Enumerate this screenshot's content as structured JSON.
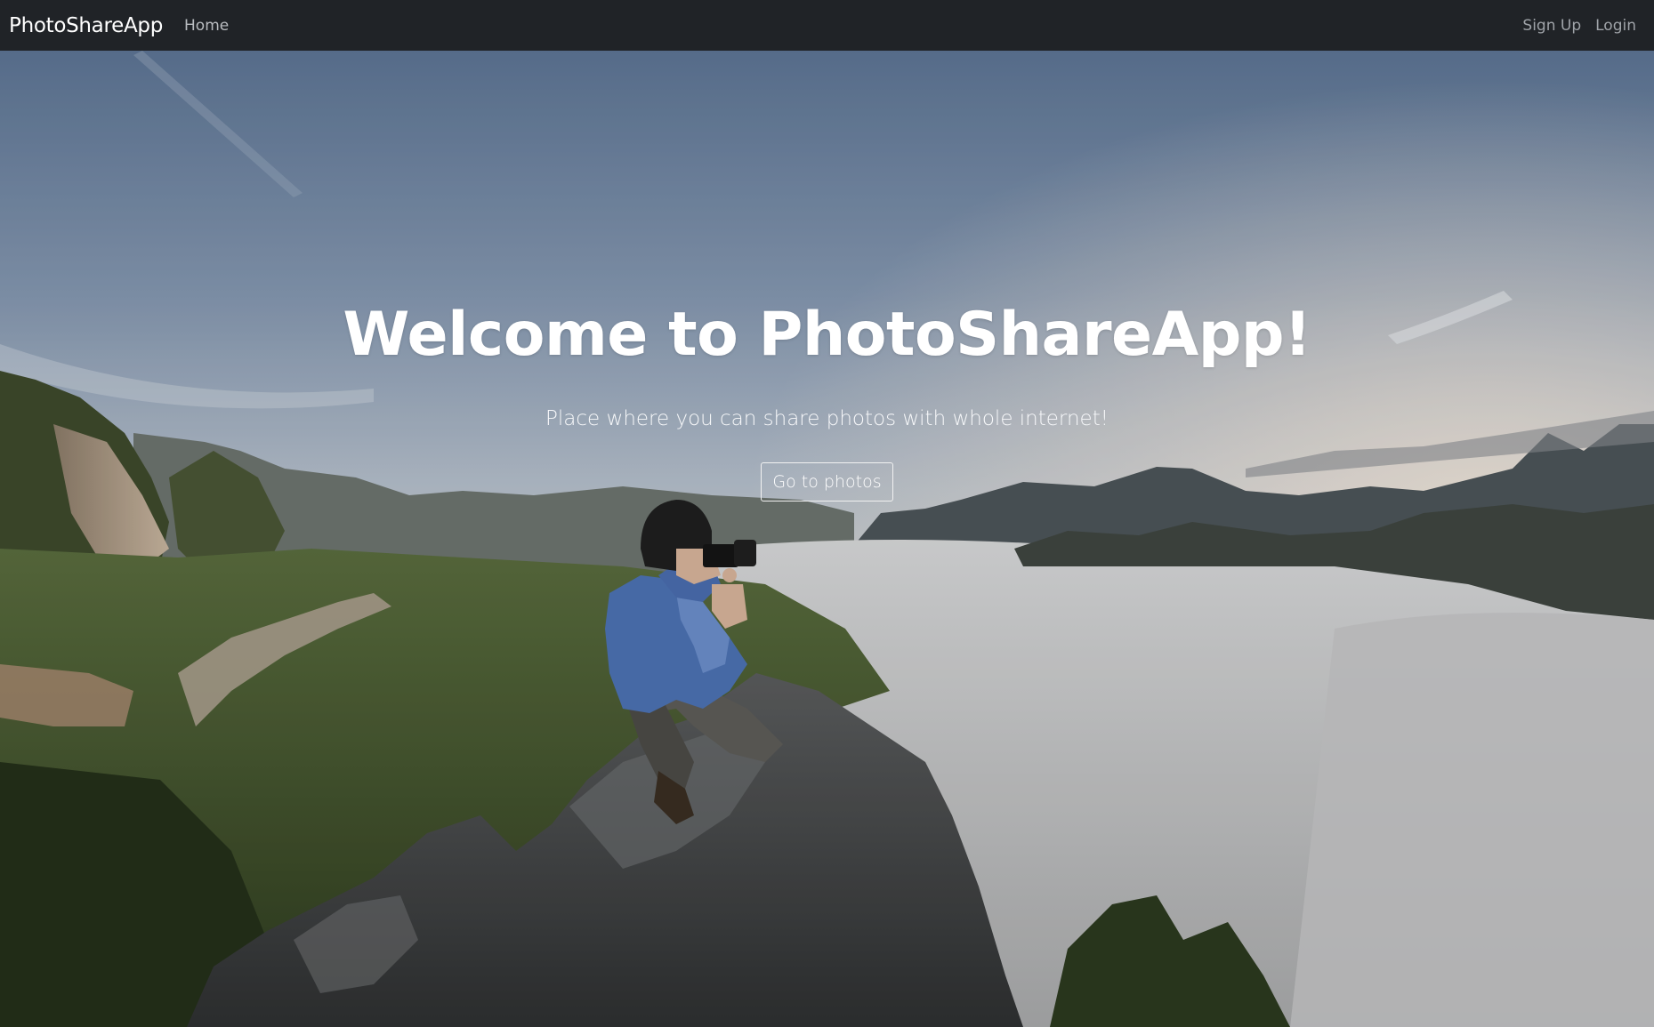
{
  "navbar": {
    "brand": "PhotoShareApp",
    "home_label": "Home",
    "signup_label": "Sign Up",
    "login_label": "Login"
  },
  "hero": {
    "title": "Welcome to PhotoShareApp!",
    "subtitle": "Place where you can share photos with whole internet!",
    "button_label": "Go to photos",
    "background_image": "photographer-on-mountain-peak-above-clouds"
  },
  "colors": {
    "navbar_bg": "#202327",
    "nav_link": "#9fa3a8",
    "hero_text": "#ffffff"
  }
}
